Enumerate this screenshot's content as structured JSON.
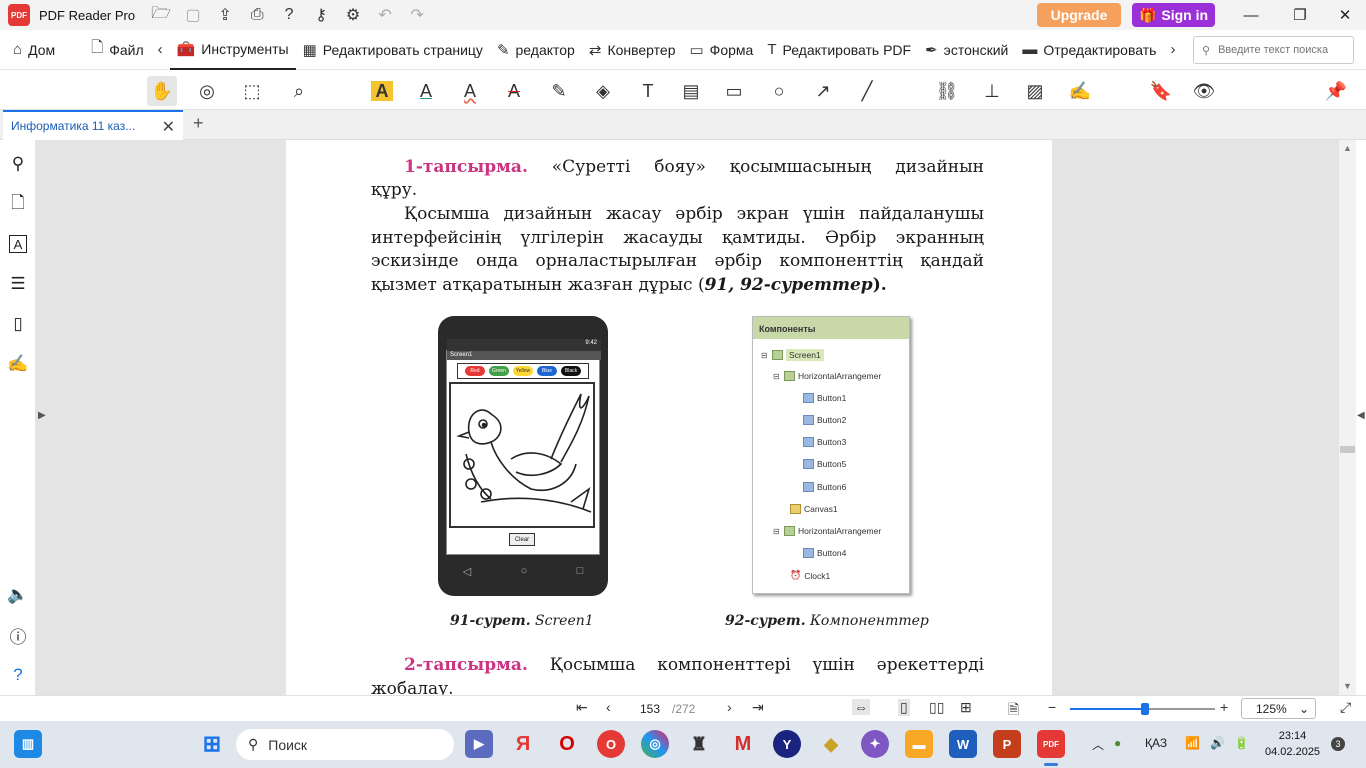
{
  "titlebar": {
    "logo_text": "PDF",
    "app_title": "PDF Reader Pro",
    "upgrade_label": "Upgrade",
    "signin_label": "Sign in",
    "minimize": "—",
    "maximize": "❐",
    "close": "✕"
  },
  "menu": {
    "items": [
      "Дом",
      "Файл",
      "Инструменты",
      "Редактировать страницу",
      "редактор",
      "Конвертер",
      "Форма",
      "Редактировать PDF",
      "эстонский",
      "Отредактировать"
    ],
    "active": "Инструменты",
    "search_placeholder": "Введите текст поиска"
  },
  "tab": {
    "title": "Информатика 11 каз...",
    "close": "✕",
    "new_tab": "+"
  },
  "document": {
    "task1_label": "1-тапсырма.",
    "task1_line1": "«Суретті бояу» қосымшасының дизайнын",
    "task1_line2": "құру.",
    "para_line1": "Қосымша дизайнын жасау әрбір экран үшін пайдаланушы",
    "para_line2": "интерфейсінің үлгілерін жасауды қамтиды. Әрбір экранның",
    "para_line3": "эскизінде онда орналастырылған әрбір компоненттің қандай",
    "para_line4_start": "қызмет атқаратынын жазған дұрыс (",
    "para_line4_ref": "91, 92-суреттер",
    "para_line4_end": ").",
    "phone": {
      "screen_title": "Screen1",
      "buttons": [
        "Red",
        "Green",
        "Yellow",
        "Blue",
        "Black"
      ],
      "button_colors": [
        "#e53935",
        "#43a047",
        "#fdd835",
        "#1e66d0",
        "#111111"
      ],
      "clear_label": "Clear",
      "time": "9:42"
    },
    "components": {
      "header": "Компоненты",
      "items": [
        "Screen1",
        "HorizontalArrangemer",
        "Button1",
        "Button2",
        "Button3",
        "Button5",
        "Button6",
        "Canvas1",
        "HorizontalArrangemer",
        "Button4",
        "Clock1"
      ]
    },
    "caption1_bold": "91-сурет.",
    "caption1_text": "Screen1",
    "caption2_bold": "92-сурет.",
    "caption2_text": "Компоненттер",
    "task2_label": "2-тапсырма.",
    "task2_line1": "Қосымша компоненттері үшін әрекеттерді",
    "task2_line2": "жобалау."
  },
  "status": {
    "current_page": "153",
    "total_pages": "/272",
    "zoom": "125%",
    "zoom_fraction": 0.52
  },
  "taskbar": {
    "search_label": "Поиск",
    "lang": "ҚАЗ",
    "time": "23:14",
    "date": "04.02.2025",
    "notifications": "3"
  }
}
